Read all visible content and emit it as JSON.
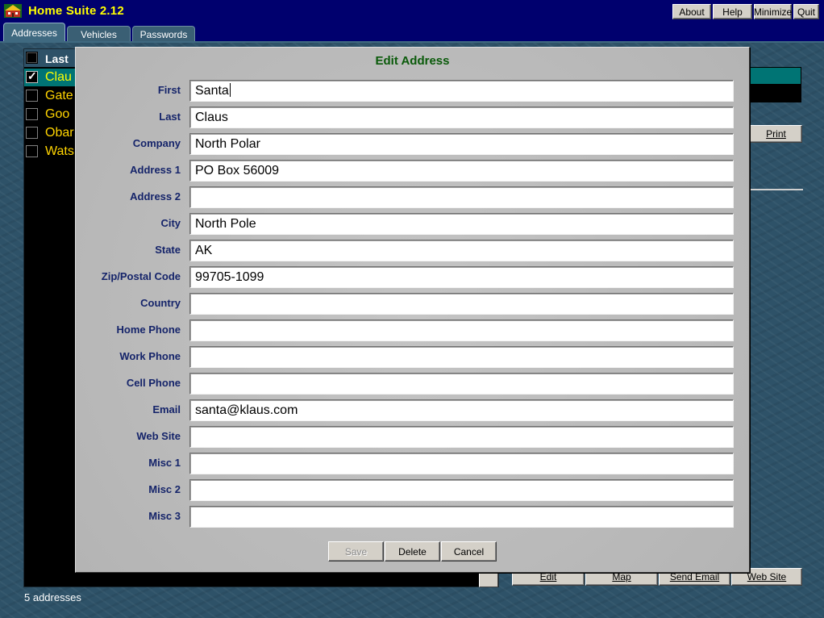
{
  "app": {
    "title": "Home Suite 2.12",
    "buttons": {
      "about": "About",
      "help": "Help",
      "minimize": "Minimize",
      "quit": "Quit"
    }
  },
  "tabs": [
    {
      "label": "Addresses",
      "active": true
    },
    {
      "label": "Vehicles",
      "active": false
    },
    {
      "label": "Passwords",
      "active": false
    }
  ],
  "list": {
    "header": "Last",
    "rows": [
      {
        "name": "Clau",
        "checked": true,
        "selected": true
      },
      {
        "name": "Gate",
        "checked": false,
        "selected": false
      },
      {
        "name": "Goo",
        "checked": false,
        "selected": false
      },
      {
        "name": "Obar",
        "checked": false,
        "selected": false
      },
      {
        "name": "Wats",
        "checked": false,
        "selected": false
      }
    ],
    "status": "5 addresses"
  },
  "right_panel": {
    "print": "Print",
    "buttons": {
      "edit": "Edit",
      "map": "Map",
      "send_email": "Send Email",
      "web_site": "Web Site"
    }
  },
  "dialog": {
    "title": "Edit Address",
    "fields": [
      {
        "label": "First",
        "value": "Santa",
        "focused": true
      },
      {
        "label": "Last",
        "value": "Claus"
      },
      {
        "label": "Company",
        "value": "North Polar"
      },
      {
        "label": "Address 1",
        "value": "PO Box 56009"
      },
      {
        "label": "Address 2",
        "value": ""
      },
      {
        "label": "City",
        "value": "North Pole"
      },
      {
        "label": "State",
        "value": "AK"
      },
      {
        "label": "Zip/Postal Code",
        "value": "99705-1099"
      },
      {
        "label": "Country",
        "value": ""
      },
      {
        "label": "Home Phone",
        "value": ""
      },
      {
        "label": "Work Phone",
        "value": ""
      },
      {
        "label": "Cell Phone",
        "value": ""
      },
      {
        "label": "Email",
        "value": "santa@klaus.com"
      },
      {
        "label": "Web Site",
        "value": ""
      },
      {
        "label": "Misc 1",
        "value": ""
      },
      {
        "label": "Misc 2",
        "value": ""
      },
      {
        "label": "Misc 3",
        "value": ""
      }
    ],
    "buttons": {
      "save": "Save",
      "delete": "Delete",
      "cancel": "Cancel"
    }
  },
  "colors": {
    "title_text": "#ffff00",
    "title_bar": "#00006e",
    "dialog_title": "#0a5a0a",
    "field_label": "#15246a",
    "list_name": "#ffd400",
    "selection": "#007474"
  }
}
